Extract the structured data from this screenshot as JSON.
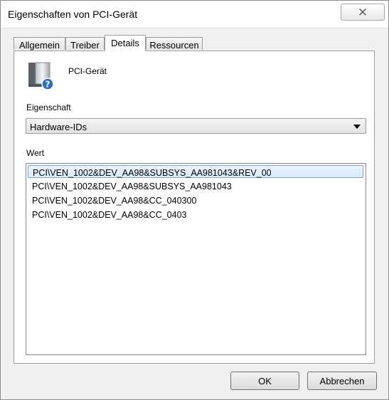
{
  "window": {
    "title": "Eigenschaften von PCI-Gerät",
    "close_glyph": "✕"
  },
  "tabs": [
    {
      "label": "Allgemein"
    },
    {
      "label": "Treiber"
    },
    {
      "label": "Details",
      "active": true
    },
    {
      "label": "Ressourcen"
    }
  ],
  "device": {
    "name": "PCI-Gerät",
    "icon": "pci-device-icon"
  },
  "property": {
    "label": "Eigenschaft",
    "selected": "Hardware-IDs"
  },
  "value": {
    "label": "Wert",
    "items": [
      "PCI\\VEN_1002&DEV_AA98&SUBSYS_AA981043&REV_00",
      "PCI\\VEN_1002&DEV_AA98&SUBSYS_AA981043",
      "PCI\\VEN_1002&DEV_AA98&CC_040300",
      "PCI\\VEN_1002&DEV_AA98&CC_0403"
    ],
    "selected_index": 0
  },
  "buttons": {
    "ok": "OK",
    "cancel": "Abbrechen"
  },
  "colors": {
    "selection_border": "#7da2ce",
    "selection_fill": "#dbeafc",
    "window_bg": "#f0f0f0"
  }
}
